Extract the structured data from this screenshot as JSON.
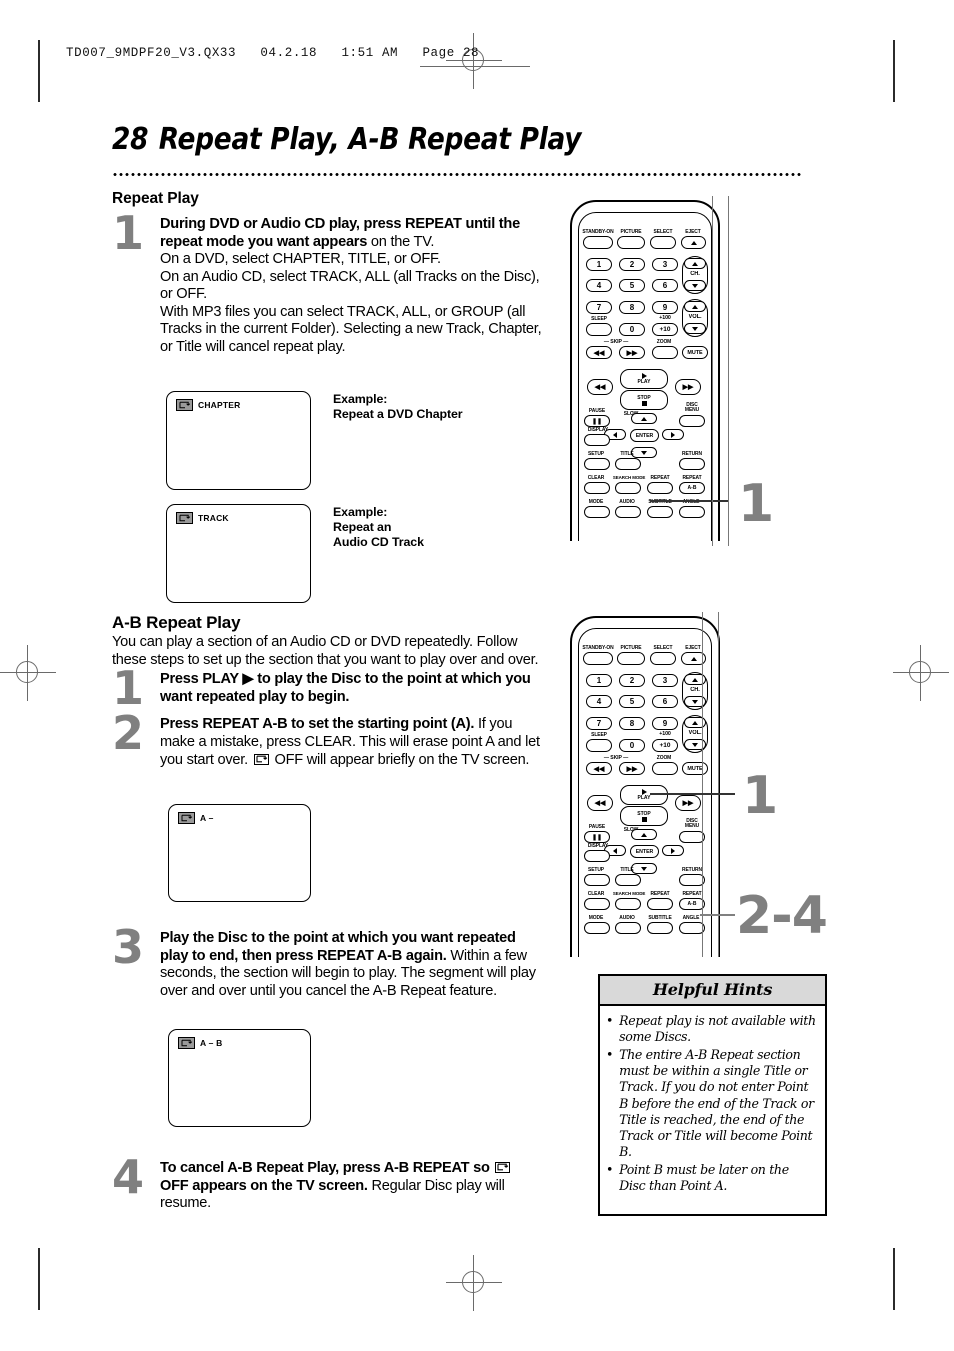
{
  "print_slug": "TD007_9MDPF20_V3.QX33   04.2.18   1:51 AM   Page 28",
  "page": {
    "number": "28",
    "title": "Repeat Play, A-B Repeat Play"
  },
  "sections": {
    "repeat_play": {
      "heading": "Repeat Play",
      "steps": [
        {
          "number": "1",
          "bold": "During DVD or Audio CD play, press REPEAT until the repeat mode you want appears",
          "rest": " on the TV.",
          "lines": [
            "On a DVD, select CHAPTER, TITLE, or OFF.",
            "On an Audio CD, select TRACK,  ALL (all Tracks on the Disc), or OFF.",
            "With MP3 files you can select TRACK, ALL, or GROUP (all Tracks in the current Folder). Selecting a new Track, Chapter, or Title will cancel repeat play."
          ]
        }
      ],
      "examples": [
        {
          "osd_label": "CHAPTER",
          "caption_line1": "Example:",
          "caption_line2": "Repeat a DVD Chapter",
          "caption_line3": ""
        },
        {
          "osd_label": "TRACK",
          "caption_line1": "Example:",
          "caption_line2": "Repeat an",
          "caption_line3": "Audio CD Track"
        }
      ]
    },
    "ab_repeat_play": {
      "heading": "A-B Repeat Play",
      "intro": "You can play a section of an Audio CD or DVD repeatedly. Follow these steps to set up the section that you want to play over and over.",
      "steps": [
        {
          "number": "1",
          "bold_pre": "Press PLAY ",
          "arrow": "▶",
          "bold_post": " to play the Disc to the point at which you want repeated play to begin.",
          "rest": ""
        },
        {
          "number": "2",
          "bold_pre": "Press REPEAT A-B to set the starting point (A).",
          "rest_a": "  If you make a mistake, press CLEAR.  This will erase point A and let you start over.  ",
          "rest_b": "  OFF will appear briefly on the TV screen."
        },
        {
          "number": "3",
          "bold_pre": "Play the Disc to the point at which you want repeated play to end, then press REPEAT A-B again.",
          "rest_a": "  Within a few seconds, the section will begin to play.  The segment will play over and over until you cancel the A-B Repeat feature.",
          "rest_b": ""
        },
        {
          "number": "4",
          "bold_pre": "To cancel A-B Repeat Play, press A-B REPEAT so ",
          "bold_post": " OFF appears on the TV screen.",
          "rest_a": " Regular Disc play will resume.",
          "rest_b": ""
        }
      ],
      "osd_boxes": [
        {
          "label": "A –"
        },
        {
          "label": "A – B"
        }
      ]
    }
  },
  "helpful_hints": {
    "title": "Helpful Hints",
    "bullet": "•",
    "items": [
      "Repeat play is not available with some Discs.",
      "The entire A-B Repeat section must be within a single Title or Track.  If you do not enter Point B before the end of the Track or Title is reached, the end of the Track or Title will become Point B.",
      "Point B must be later on the Disc than Point A."
    ]
  },
  "remote": {
    "rows": {
      "r1": [
        "STANDBY-ON",
        "PICTURE",
        "SELECT",
        "EJECT"
      ],
      "r2": [
        "1",
        "2",
        "3"
      ],
      "r3": [
        "4",
        "5",
        "6"
      ],
      "r4": [
        "7",
        "8",
        "9"
      ],
      "r5": [
        "SLEEP",
        "0",
        "+10"
      ],
      "r6": [
        "SKIP",
        "ZOOM",
        "MUTE"
      ]
    },
    "side_labels": {
      "ch": "CH.",
      "vol": "VOL.",
      "plus100": "+100"
    },
    "transport": {
      "play": "PLAY",
      "stop": "STOP",
      "slow": "SLOW",
      "pause": "PAUSE"
    },
    "nav": {
      "enter": "ENTER",
      "disc_menu_line1": "DISC",
      "disc_menu_line2": "MENU"
    },
    "func_rows": {
      "a": [
        "DISPLAY"
      ],
      "b": [
        "SETUP",
        "TITLE",
        "RETURN"
      ],
      "c": [
        "CLEAR",
        "SEARCH MODE",
        "REPEAT",
        "REPEAT"
      ],
      "c_sub": "A-B",
      "d": [
        "MODE",
        "AUDIO",
        "SUBTITLE",
        "ANGLE"
      ]
    },
    "callouts": {
      "top_remote": "1",
      "bottom_remote_play": "1",
      "bottom_remote_ab": "2-4"
    }
  }
}
